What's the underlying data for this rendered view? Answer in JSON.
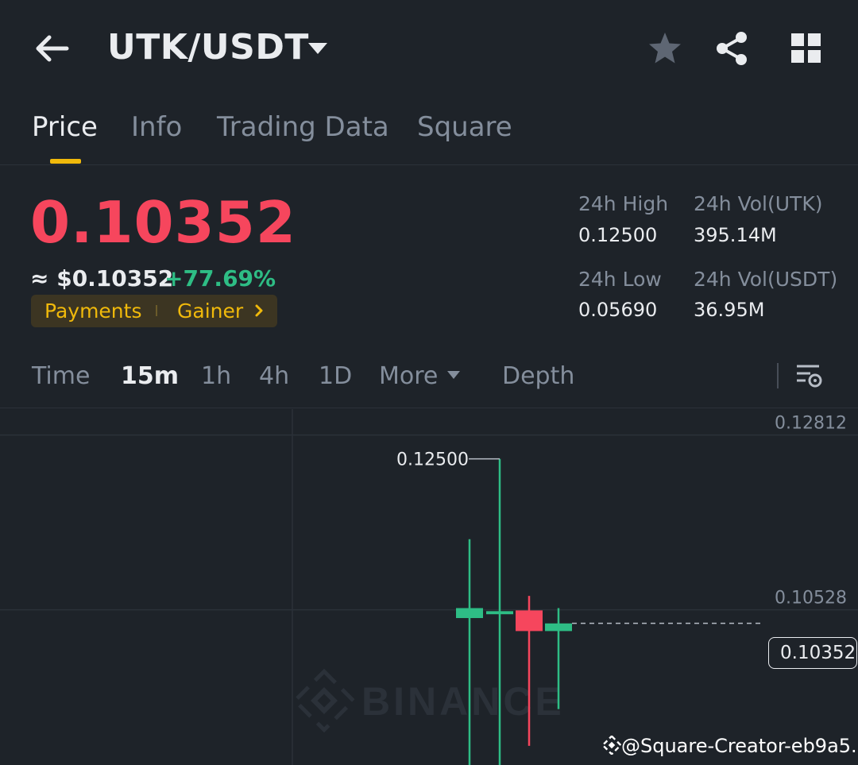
{
  "header": {
    "pair": "UTK/USDT",
    "icons": [
      "back-arrow-icon",
      "caret-down-icon",
      "star-icon",
      "share-icon",
      "grid-icon"
    ]
  },
  "tabs": [
    {
      "label": "Price",
      "active": true
    },
    {
      "label": "Info"
    },
    {
      "label": "Trading Data"
    },
    {
      "label": "Square"
    }
  ],
  "ticker": {
    "last_price": "0.10352",
    "usd_price": "≈ $0.10352",
    "change": "+77.69%",
    "tags": [
      "Payments",
      "Gainer"
    ],
    "high_label": "24h High",
    "high_value": "0.12500",
    "low_label": "24h Low",
    "low_value": "0.05690",
    "vol_base_label": "24h Vol(UTK)",
    "vol_base_value": "395.14M",
    "vol_quote_label": "24h Vol(USDT)",
    "vol_quote_value": "36.95M"
  },
  "intervals": [
    {
      "label": "Time"
    },
    {
      "label": "15m",
      "active": true
    },
    {
      "label": "1h"
    },
    {
      "label": "4h"
    },
    {
      "label": "1D"
    },
    {
      "label": "More"
    },
    {
      "label": "Depth"
    }
  ],
  "chart_data": {
    "type": "candlestick",
    "y_axis_labels": [
      "0.12812",
      "0.10528"
    ],
    "ylim": [
      0.085,
      0.1315
    ],
    "current_price": "0.10352",
    "high_marker": "0.12500",
    "watermark": "BINANCE",
    "candles": [
      {
        "open": 0.1042,
        "high": 0.1145,
        "low": 0.085,
        "close": 0.1055,
        "direction": "up"
      },
      {
        "open": 0.1047,
        "high": 0.125,
        "low": 0.085,
        "close": 0.1051,
        "direction": "up"
      },
      {
        "open": 0.1052,
        "high": 0.1071,
        "low": 0.0875,
        "close": 0.1025,
        "direction": "down"
      },
      {
        "open": 0.1025,
        "high": 0.1055,
        "low": 0.0923,
        "close": 0.1035,
        "direction": "up"
      }
    ],
    "colors": {
      "up": "#2ebd85",
      "down": "#f6465d",
      "grid": "#2b3139",
      "axis_text": "#848e9c"
    }
  },
  "footer": {
    "creator": "@Square-Creator-eb9a5..."
  },
  "colors": {
    "background": "#1e2329",
    "accent": "#f0b90b",
    "down": "#f6465d",
    "up": "#2ebd85",
    "muted": "#848e9c"
  }
}
